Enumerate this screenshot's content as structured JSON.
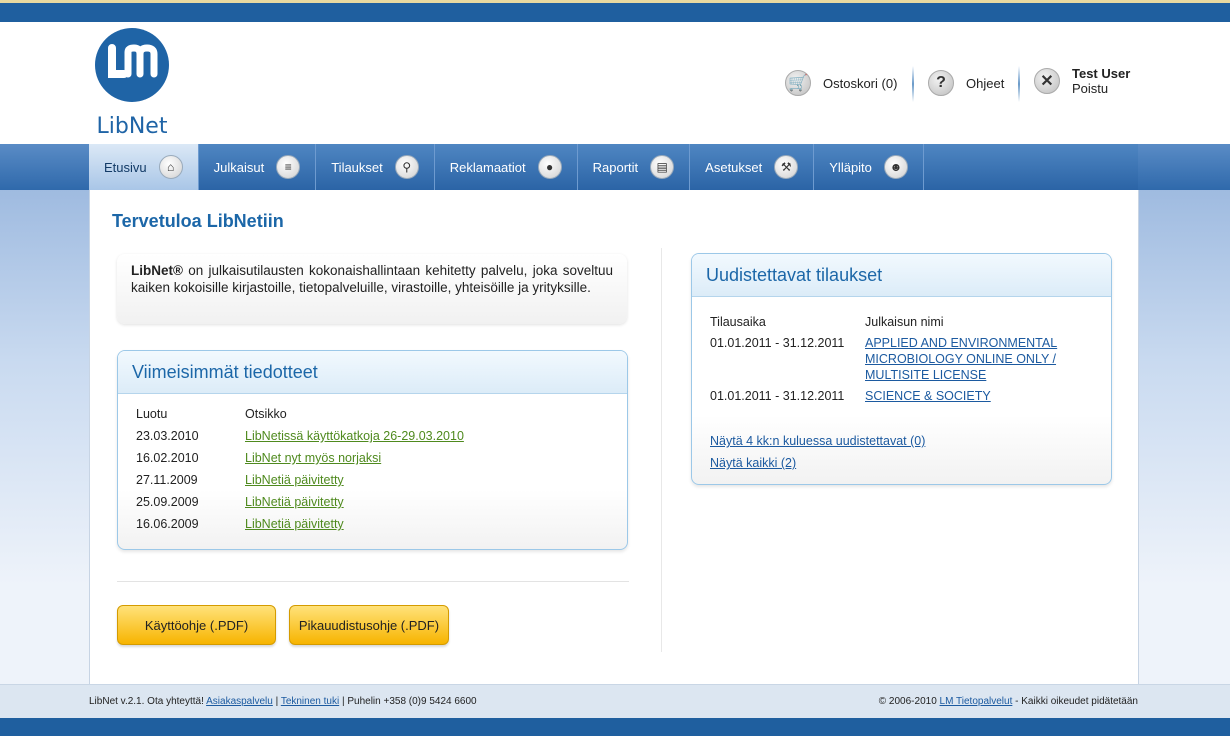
{
  "logo": {
    "text": "LibNet"
  },
  "header": {
    "cart_label": "Ostoskori (0)",
    "help_label": "Ohjeet",
    "user_name": "Test User",
    "logout_label": "Poistu"
  },
  "nav": {
    "items": [
      {
        "label": "Etusivu",
        "icon": "home-icon"
      },
      {
        "label": "Julkaisut",
        "icon": "stack-icon"
      },
      {
        "label": "Tilaukset",
        "icon": "search-icon"
      },
      {
        "label": "Reklamaatiot",
        "icon": "speech-bubble-icon"
      },
      {
        "label": "Raportit",
        "icon": "document-icon"
      },
      {
        "label": "Asetukset",
        "icon": "wrench-icon"
      },
      {
        "label": "Ylläpito",
        "icon": "users-icon"
      }
    ]
  },
  "page": {
    "title": "Tervetuloa LibNetiin",
    "intro_brand": "LibNet®",
    "intro_text": " on julkaisutilausten kokonaishallintaan kehitetty palvelu, joka soveltuu kaiken kokoisille kirjastoille, tietopalveluille, virastoille, yhteisöille ja yrityksille."
  },
  "news": {
    "title": "Viimeisimmät tiedotteet",
    "col_date": "Luotu",
    "col_title": "Otsikko",
    "rows": [
      {
        "date": "23.03.2010",
        "title": "LibNetissä käyttökatkoja 26-29.03.2010"
      },
      {
        "date": "16.02.2010",
        "title": "LibNet nyt myös norjaksi"
      },
      {
        "date": "27.11.2009",
        "title": "LibNetiä päivitetty"
      },
      {
        "date": "25.09.2009",
        "title": "LibNetiä päivitetty"
      },
      {
        "date": "16.06.2009",
        "title": "LibNetiä päivitetty"
      }
    ]
  },
  "renewals": {
    "title": "Uudistettavat tilaukset",
    "col_period": "Tilausaika",
    "col_name": "Julkaisun nimi",
    "rows": [
      {
        "period": "01.01.2011 - 31.12.2011",
        "name": "APPLIED AND ENVIRONMENTAL MICROBIOLOGY ONLINE ONLY / MULTISITE LICENSE"
      },
      {
        "period": "01.01.2011 - 31.12.2011",
        "name": "SCIENCE & SOCIETY"
      }
    ],
    "link_4months": "Näytä 4 kk:n kuluessa uudistettavat (0)",
    "link_all": "Näytä kaikki (2)"
  },
  "buttons": {
    "manual": "Käyttöohje (.PDF)",
    "quick_renew": "Pikauudistusohje (.PDF)"
  },
  "footer": {
    "left_prefix": "LibNet v.2.1. Ota yhteyttä! ",
    "customer_service": "Asiakaspalvelu",
    "sep1": " | ",
    "tech_support": "Tekninen tuki",
    "phone": " | Puhelin +358 (0)9 5424 6600",
    "copyright_prefix": "© 2006-2010 ",
    "company": "LM Tietopalvelut",
    "rights": " - Kaikki oikeudet pidätetään"
  },
  "colors": {
    "brand_blue": "#1f5f9f",
    "title_blue": "#1c67a8",
    "link_green": "#4f8a1e",
    "button_yellow": "#f7b400"
  }
}
